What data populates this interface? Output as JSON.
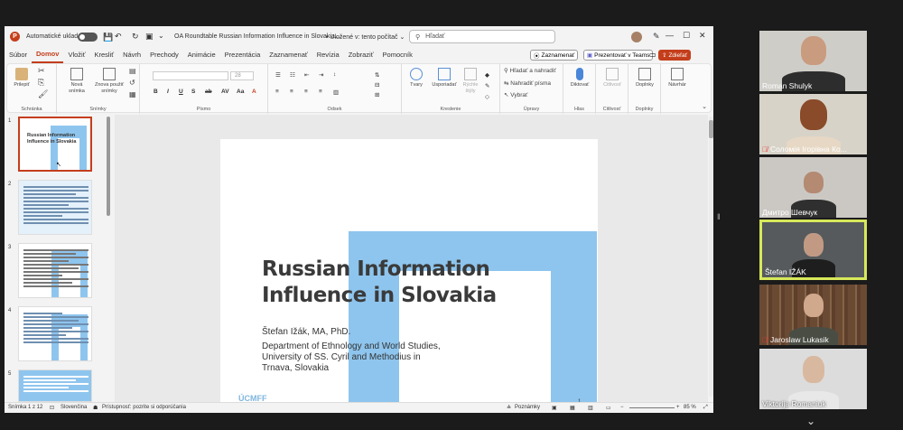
{
  "app": {
    "logo_letter": "P",
    "autosave_label": "Automatické ukladanie",
    "document_title": "OA Roundtable Russian Information Influence in Slovakia....",
    "save_state": "• Uložené v: tento počítač ⌄",
    "search_placeholder": "Hľadať"
  },
  "menu": {
    "tabs": [
      "Súbor",
      "Domov",
      "Vložiť",
      "Kresliť",
      "Návrh",
      "Prechody",
      "Animácie",
      "Prezentácia",
      "Zaznamenať",
      "Revízia",
      "Zobraziť",
      "Pomocník"
    ],
    "active_tab": "Domov",
    "record_label": "Zaznamenať",
    "teams_label": "Prezentovať v Teams",
    "share_label": "Zdieľať"
  },
  "ribbon": {
    "paste": "Prilepiť",
    "new_slide": "Nová snímka",
    "reuse_slides": "Znova použiť snímky",
    "font_size": "28",
    "shapes": "Tvary",
    "arrange": "Usporiadať",
    "quick_styles": "Rýchle štýly",
    "find": "Hľadať a nahradiť",
    "replace_fonts": "Nahradiť písma",
    "select": "Vybrať",
    "dictate": "Diktovať",
    "sensitivity": "Citlivosť",
    "addins": "Doplnky",
    "designer": "Návrhár",
    "groups": {
      "clipboard": "Schránka",
      "slides": "Snímky",
      "font": "Písmo",
      "paragraph": "Odsek",
      "drawing": "Kreslenie",
      "editing": "Úpravy",
      "voice": "Hlas",
      "sensitivity": "Citlivosť",
      "addins": "Doplnky"
    }
  },
  "thumbnails": [
    {
      "num": "1",
      "title": "Russian Information Influence in Slovakia"
    },
    {
      "num": "2"
    },
    {
      "num": "3"
    },
    {
      "num": "4"
    },
    {
      "num": "5"
    }
  ],
  "slide": {
    "title": "Russian Information Influence in Slovakia",
    "author": "Štefan Ižák, MA, PhD.",
    "department": "Department of Ethnology and World Studies, University of SS. Cyril and Methodius in Trnava, Slovakia",
    "logo": "ÚCMFF",
    "number": "1"
  },
  "status": {
    "slide_counter": "Snímka 1 z 12",
    "language": "Slovenčina",
    "accessibility": "Prístupnosť: pozrite si odporúčania",
    "notes": "Poznámky",
    "zoom": "85 %"
  },
  "participants": [
    {
      "name": "Roman Shulyk",
      "muted": false
    },
    {
      "name": "Соломія Ігорівна Ко...",
      "muted": true
    },
    {
      "name": "Дмитро Шевчук",
      "muted": false
    },
    {
      "name": "Štefan IŽÁK",
      "muted": false,
      "active": true
    },
    {
      "name": "Jaroslaw Lukasik",
      "muted": true
    },
    {
      "name": "Viktorija Romaniuk",
      "muted": false
    }
  ],
  "colors": {
    "accent": "#c43e1c",
    "slide_blue": "#8ec5ee",
    "active_speaker": "#d7e85a"
  }
}
